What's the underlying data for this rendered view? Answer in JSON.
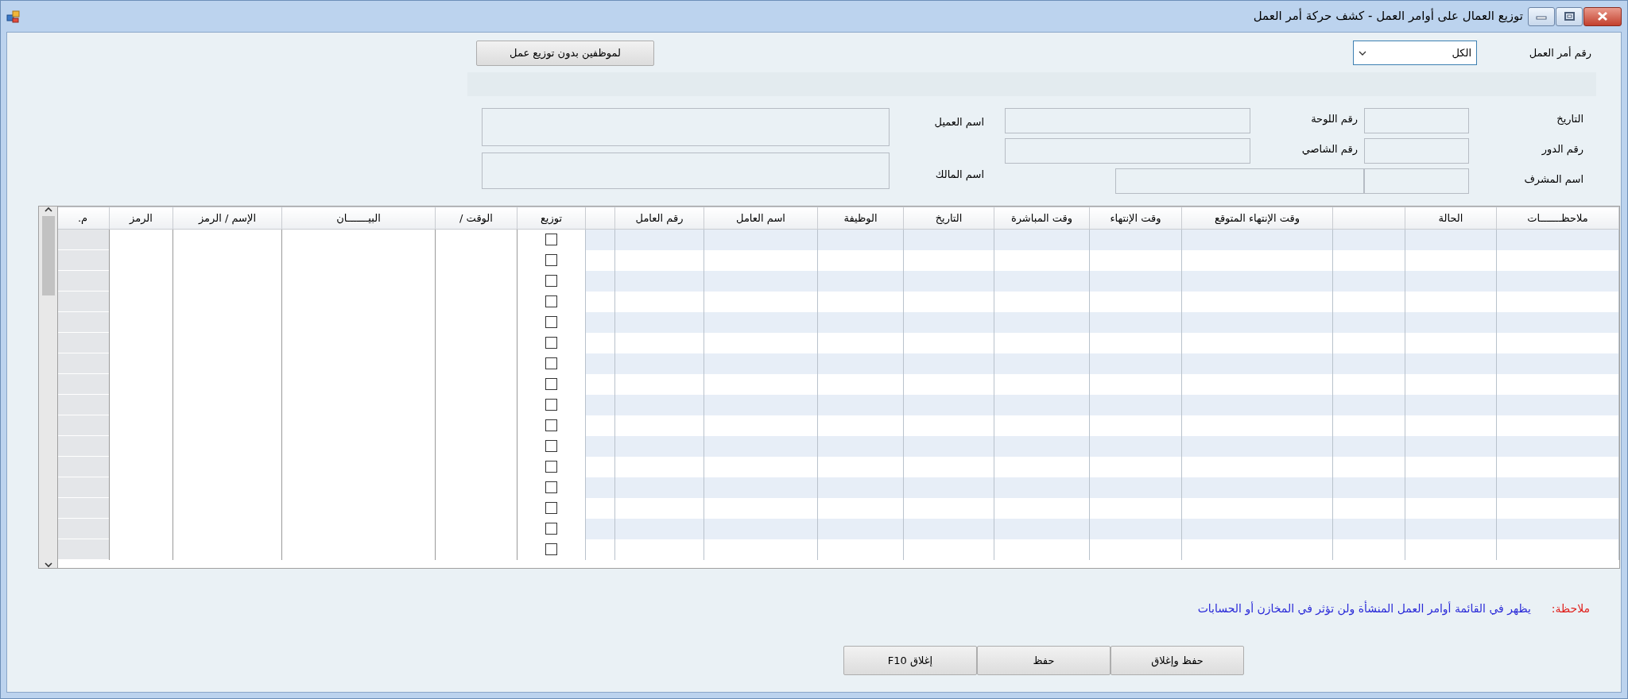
{
  "window": {
    "title": "توزيع العمال على أوامر العمل - كشف حركة أمر العمل"
  },
  "work_order": {
    "label": "رقم أمر العمل",
    "value": "الكل"
  },
  "unassigned_button": "لموظفين بدون توزيع عمل",
  "info": {
    "date_label": "التاريخ",
    "plate_label": "رقم اللوحة",
    "floor_label": "رقم الدور",
    "chassis_label": "رقم الشاصي",
    "supervisor_label": "اسم المشرف",
    "customer_label": "اسم العميل",
    "owner_label": "اسم المالك"
  },
  "table": {
    "columns": [
      {
        "kind": "text",
        "label": "ملاحظـــــــات",
        "striped": true
      },
      {
        "kind": "text",
        "label": "الحالة",
        "striped": true
      },
      {
        "kind": "blank",
        "striped": true
      },
      {
        "kind": "text",
        "label": "وقت الإنتهاء المتوقع",
        "striped": true
      },
      {
        "kind": "text",
        "label": "وقت الإنتهاء",
        "striped": true
      },
      {
        "kind": "text",
        "label": "وقت المباشرة",
        "striped": true
      },
      {
        "kind": "text",
        "label": "التاريخ",
        "striped": true
      },
      {
        "kind": "text",
        "label": "الوظيفة",
        "striped": true
      },
      {
        "kind": "text",
        "label": "اسم العامل",
        "striped": true
      },
      {
        "kind": "text",
        "label": "رقم العامل",
        "striped": true
      },
      {
        "kind": "blank",
        "striped": true
      },
      {
        "kind": "check",
        "label": "توزيع",
        "striped": false
      },
      {
        "kind": "text",
        "label": "الوقت /",
        "striped": false
      },
      {
        "kind": "text",
        "label": "البيـــــــان",
        "striped": false
      },
      {
        "kind": "text",
        "label": "الإسم / الرمز",
        "striped": false
      },
      {
        "kind": "text",
        "label": "الرمز",
        "striped": false
      },
      {
        "kind": "rowhead",
        "label": "م."
      }
    ],
    "rows": [
      {
        "checked": false
      },
      {
        "checked": false
      },
      {
        "checked": false
      },
      {
        "checked": false
      },
      {
        "checked": false
      },
      {
        "checked": false
      },
      {
        "checked": false
      },
      {
        "checked": false
      },
      {
        "checked": false
      },
      {
        "checked": false
      },
      {
        "checked": false
      },
      {
        "checked": false
      },
      {
        "checked": false
      },
      {
        "checked": false
      },
      {
        "checked": false
      },
      {
        "checked": false
      }
    ]
  },
  "note": {
    "label": "ملاحظة:",
    "text": "يظهر في القائمة أوامر العمل المنشأة ولن تؤثر في المخازن أو الحسابات"
  },
  "buttons": [
    "حفظ وإغلاق",
    "حفظ",
    "إغلاق F10"
  ]
}
